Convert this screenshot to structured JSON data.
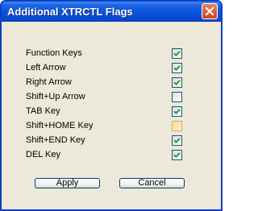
{
  "window": {
    "title": "Additional XTRCTL Flags"
  },
  "icons": {
    "close": "close-icon",
    "check": "check-icon"
  },
  "flags": [
    {
      "label": "Function Keys",
      "checked": true,
      "highlighted": false
    },
    {
      "label": "Left Arrow",
      "checked": true,
      "highlighted": false
    },
    {
      "label": "Right Arrow",
      "checked": true,
      "highlighted": false
    },
    {
      "label": "Shift+Up Arrow",
      "checked": false,
      "highlighted": false
    },
    {
      "label": "TAB Key",
      "checked": true,
      "highlighted": false
    },
    {
      "label": "Shift+HOME Key",
      "checked": false,
      "highlighted": true
    },
    {
      "label": "Shift+END Key",
      "checked": true,
      "highlighted": false
    },
    {
      "label": "DEL Key",
      "checked": true,
      "highlighted": false
    }
  ],
  "buttons": {
    "apply_label": "Apply",
    "cancel_label": "Cancel"
  },
  "colors": {
    "titlebar": "#0a55e0",
    "window_bg": "#ece9d8",
    "check": "#21a121"
  }
}
